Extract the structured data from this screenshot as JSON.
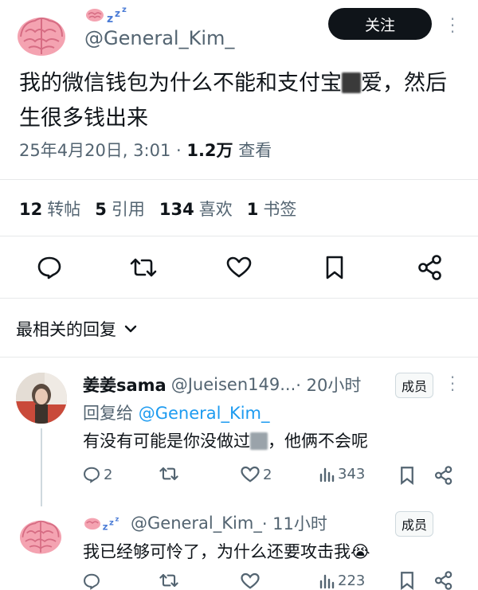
{
  "post": {
    "handle": "@General_Kim_",
    "follow_label": "关注",
    "text_part1": "我的微信钱包为什么不能和支付宝",
    "text_part2": "爱，然后生很多钱出来",
    "date": "25年4月20日, 3:01 · ",
    "views_count": "1.2万",
    "views_label": " 查看"
  },
  "stats": {
    "reposts_count": "12",
    "reposts_label": "转帖",
    "quotes_count": "5",
    "quotes_label": "引用",
    "likes_count": "134",
    "likes_label": "喜欢",
    "bookmarks_count": "1",
    "bookmarks_label": "书签"
  },
  "replies_section": {
    "title": "最相关的回复"
  },
  "reply1": {
    "name": "姜姜sama",
    "handle": "@Jueisen149...",
    "time": " · 20小时",
    "badge": "成员",
    "replying_to_label": "回复给 ",
    "replying_to_handle": "@General_Kim_",
    "text_part1": "有没有可能是你没做过",
    "text_part2": "，他俩不会呢",
    "comments": "2",
    "likes": "2",
    "views": "343"
  },
  "reply2": {
    "handle": "@General_Kim_",
    "time": " · 11小时",
    "badge": "成员",
    "text": "我已经够可怜了，为什么还要攻击我😭",
    "views": "223"
  },
  "colors": {
    "accent": "#1d9bf0",
    "text": "#0f1419",
    "muted": "#536471",
    "button": "#0f1419"
  },
  "icons": [
    "brain-icon",
    "zzz-icon",
    "comment-icon",
    "repost-icon",
    "heart-icon",
    "bookmark-icon",
    "share-icon",
    "chevron-down-icon",
    "views-icon",
    "more-icon"
  ]
}
